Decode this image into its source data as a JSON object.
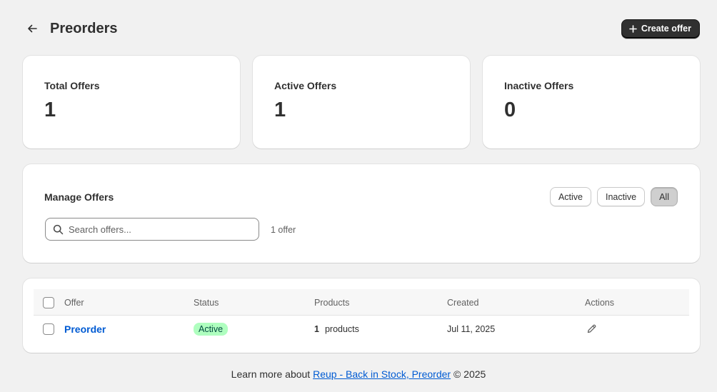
{
  "header": {
    "title": "Preorders",
    "create_label": "Create offer"
  },
  "stats": [
    {
      "label": "Total Offers",
      "value": "1"
    },
    {
      "label": "Active Offers",
      "value": "1"
    },
    {
      "label": "Inactive Offers",
      "value": "0"
    }
  ],
  "manage": {
    "title": "Manage Offers",
    "filters": [
      {
        "label": "Active",
        "selected": false
      },
      {
        "label": "Inactive",
        "selected": false
      },
      {
        "label": "All",
        "selected": true
      }
    ],
    "search_placeholder": "Search offers...",
    "count_text": "1 offer"
  },
  "table": {
    "columns": [
      "Offer",
      "Status",
      "Products",
      "Created",
      "Actions"
    ],
    "rows": [
      {
        "offer": "Preorder",
        "status": "Active",
        "products_count": "1",
        "products_label": "products",
        "created": "Jul 11, 2025"
      }
    ]
  },
  "footer": {
    "prefix": "Learn more about",
    "link_text": "Reup - Back in Stock, Preorder",
    "suffix": "© 2025"
  },
  "icons": {
    "back": "arrow-left-icon",
    "plus": "plus-icon",
    "search": "search-icon",
    "edit": "pencil-icon"
  },
  "colors": {
    "primary_button": "#303030",
    "link": "#005bd3",
    "active_badge_bg": "#affebf",
    "active_badge_text": "#014b40"
  }
}
